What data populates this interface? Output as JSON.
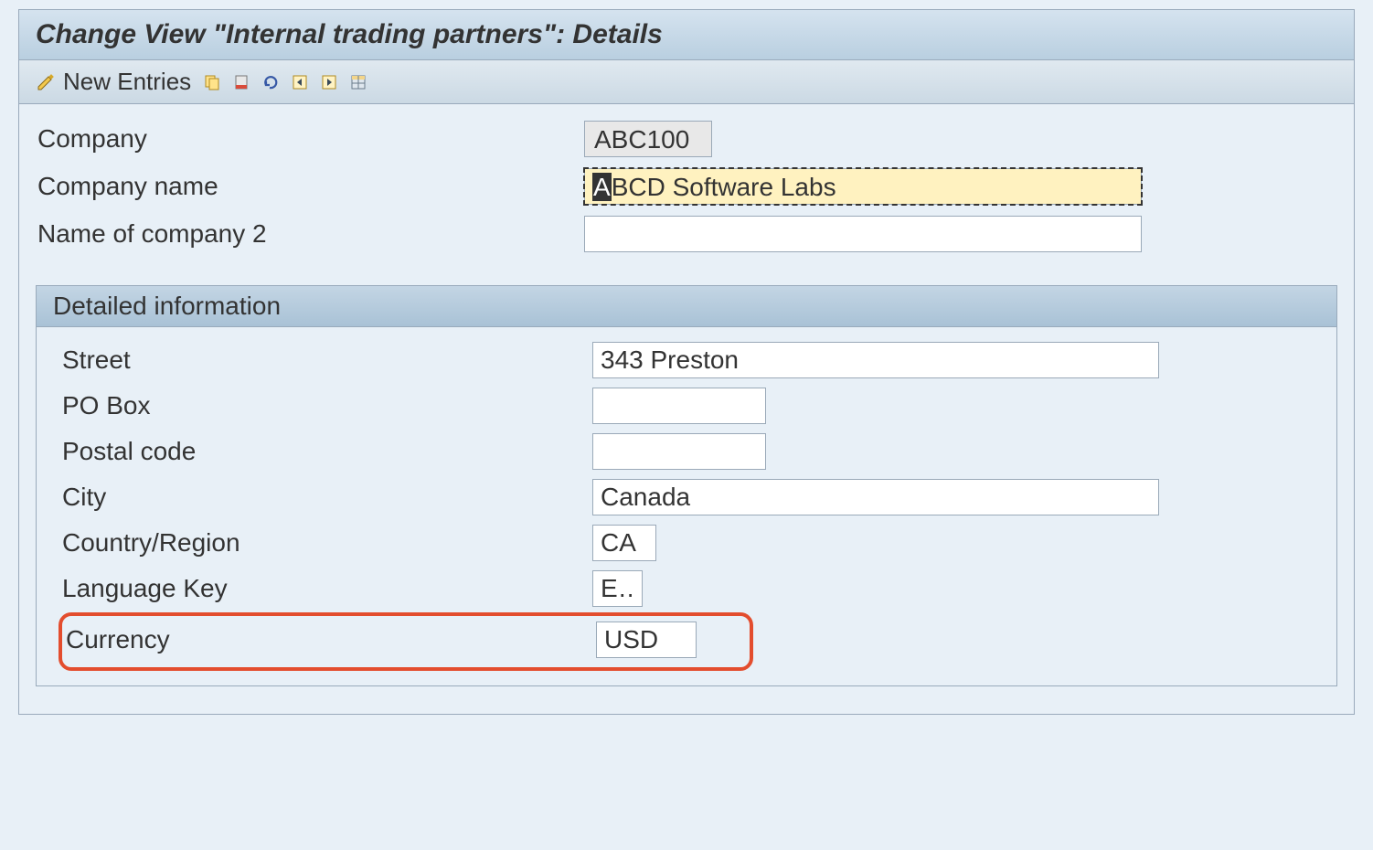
{
  "window": {
    "title": "Change View \"Internal trading partners\": Details"
  },
  "toolbar": {
    "new_entries_label": "New Entries"
  },
  "header_fields": {
    "company_label": "Company",
    "company_value": "ABC100",
    "company_name_label": "Company name",
    "company_name_value_first": "A",
    "company_name_value_rest": "BCD Software Labs",
    "name2_label": "Name of company 2",
    "name2_value": ""
  },
  "group": {
    "title": "Detailed information",
    "street_label": "Street",
    "street_value": "343 Preston",
    "pobox_label": "PO Box",
    "pobox_value": "",
    "postal_label": "Postal code",
    "postal_value": "",
    "city_label": "City",
    "city_value": "Canada",
    "country_label": "Country/Region",
    "country_value": "CA",
    "lang_label": "Language Key",
    "lang_value": "E…",
    "currency_label": "Currency",
    "currency_value": "USD"
  }
}
